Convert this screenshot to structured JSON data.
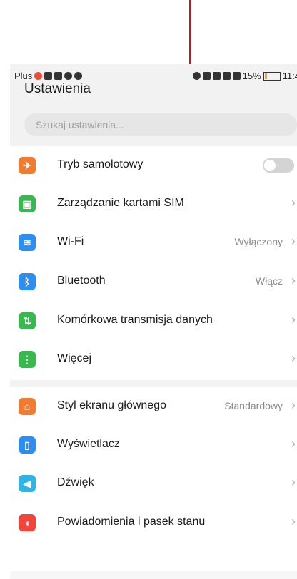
{
  "status_bar": {
    "carrier": "Plus",
    "battery_percent": "15%",
    "time": "11:4"
  },
  "header": {
    "title": "Ustawienia"
  },
  "search": {
    "placeholder": "Szukaj ustawienia..."
  },
  "group1": [
    {
      "label": "Tryb samolotowy",
      "value": "",
      "icon": "airplane-icon",
      "color": "#f07c32",
      "control": "toggle",
      "toggle_on": false
    },
    {
      "label": "Zarządzanie kartami SIM",
      "value": "",
      "icon": "sim-card-icon",
      "color": "#37b94f",
      "control": "chevron"
    },
    {
      "label": "Wi-Fi",
      "value": "Wyłączony",
      "icon": "wifi-icon",
      "color": "#2d8ef0",
      "control": "chevron"
    },
    {
      "label": "Bluetooth",
      "value": "Włącz",
      "icon": "bluetooth-icon",
      "color": "#2d8ef0",
      "control": "chevron"
    },
    {
      "label": "Komórkowa transmisja danych",
      "value": "",
      "icon": "mobile-data-icon",
      "color": "#37b94f",
      "control": "chevron"
    },
    {
      "label": "Więcej",
      "value": "",
      "icon": "more-icon",
      "color": "#37b94f",
      "control": "chevron"
    }
  ],
  "group2": [
    {
      "label": "Styl ekranu głównego",
      "value": "Standardowy",
      "icon": "home-style-icon",
      "color": "#f07c32",
      "control": "chevron"
    },
    {
      "label": "Wyświetlacz",
      "value": "",
      "icon": "display-icon",
      "color": "#2d8ef0",
      "control": "chevron"
    },
    {
      "label": "Dźwięk",
      "value": "",
      "icon": "sound-icon",
      "color": "#2fb4e8",
      "control": "chevron"
    },
    {
      "label": "Powiadomienia i pasek stanu",
      "value": "",
      "icon": "notification-bell-icon",
      "color": "#f0453a",
      "control": "chevron"
    }
  ],
  "annotation": {
    "color": "#d0101a"
  }
}
